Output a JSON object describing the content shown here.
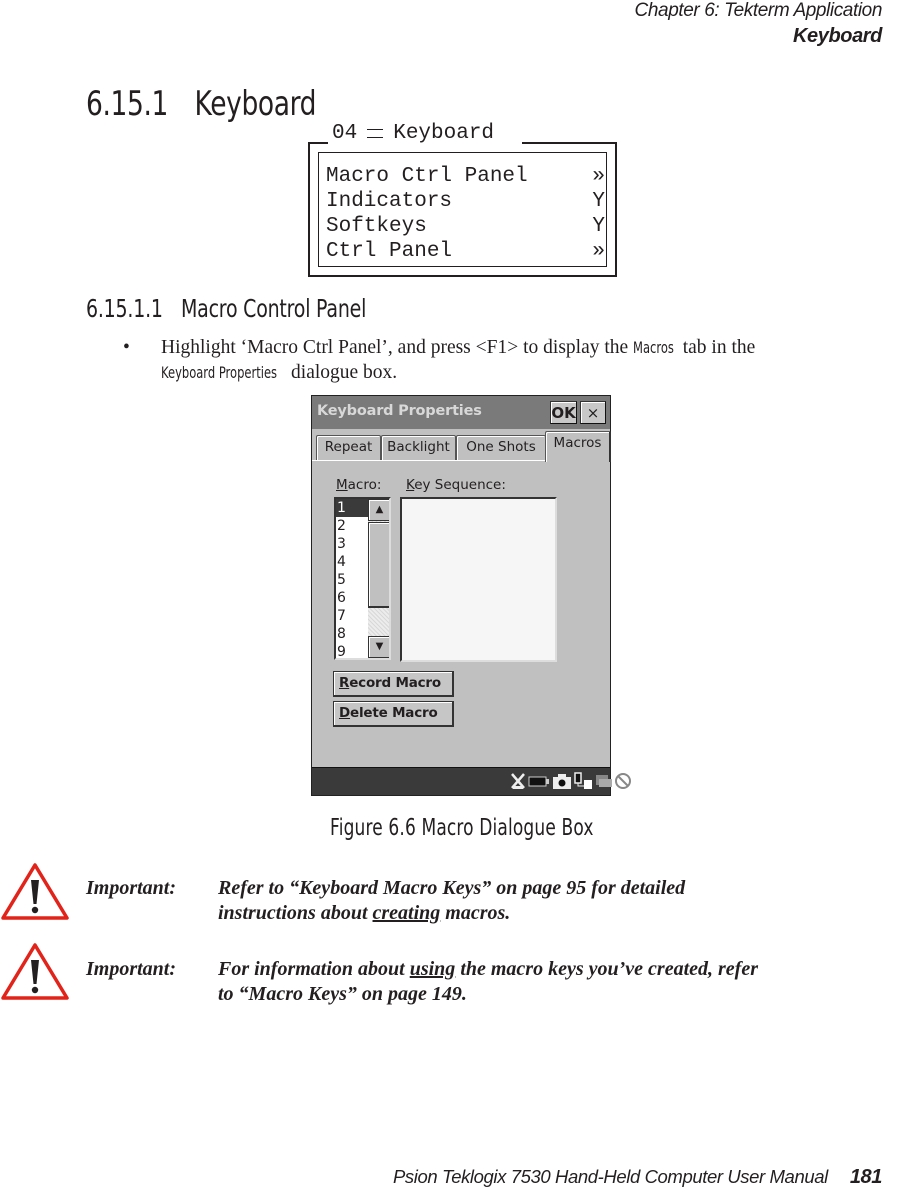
{
  "header": {
    "chapter": "Chapter  6:  Tekterm Application",
    "section": "Keyboard"
  },
  "heading1": {
    "number": "6.15.1",
    "title": "Keyboard"
  },
  "terminal_menu": {
    "screen_number": "04",
    "title": "Keyboard",
    "rows": [
      {
        "label": "Macro Ctrl Panel",
        "value": "»"
      },
      {
        "label": "Indicators",
        "value": "Y"
      },
      {
        "label": "Softkeys",
        "value": "Y"
      },
      {
        "label": "Ctrl Panel",
        "value": "»"
      }
    ]
  },
  "heading2": {
    "number": "6.15.1.1",
    "title": "Macro Control Panel"
  },
  "bullet": {
    "symbol": "•",
    "text_a": "Highlight ‘Macro Ctrl Panel’, and press <F1> to display the ",
    "ui_term_1": "Macros",
    "text_b": " tab in the ",
    "ui_term_2": "Keyboard Properties",
    "text_c": " dialogue box."
  },
  "dialog": {
    "title": "Keyboard Properties",
    "ok_label": "OK",
    "close_label": "×",
    "tabs": [
      {
        "label": "Repeat",
        "active": false
      },
      {
        "label": "Backlight",
        "active": false
      },
      {
        "label": "One Shots",
        "active": false
      },
      {
        "label": "Macros",
        "active": true
      }
    ],
    "macro_label": {
      "accel": "M",
      "rest": "acro:"
    },
    "keyseq_label": {
      "accel": "K",
      "rest": "ey Sequence:"
    },
    "macro_list": [
      "1",
      "2",
      "3",
      "4",
      "5",
      "6",
      "7",
      "8",
      "9"
    ],
    "selected_macro": "1",
    "key_sequence_value": "",
    "scroll_up": "▲",
    "scroll_down": "▼",
    "record_button": {
      "accel": "R",
      "rest": "ecord Macro"
    },
    "delete_button": {
      "accel": "D",
      "rest": "elete Macro"
    },
    "status_icons": [
      "no-network-icon",
      "battery-icon",
      "camera-icon",
      "connection-icon",
      "printer-icon",
      "no-symbol-icon"
    ]
  },
  "figure_caption": "Figure 6.6  Macro Dialogue Box",
  "notes": [
    {
      "label": "Important:",
      "line1": "Refer to “Keyboard Macro Keys” on page 95 for detailed",
      "line2_pre": "instructions about ",
      "line2_u": "creating",
      "line2_post": " macros."
    },
    {
      "label": "Important:",
      "line1_pre": "For information about ",
      "line1_u": "using",
      "line1_post": " the macro keys you’ve created, refer",
      "line2": "to “Macro Keys” on page 149."
    }
  ],
  "footer": {
    "manual_title": "Psion Teklogix 7530 Hand-Held Computer User Manual",
    "page_number": "181"
  },
  "colors": {
    "warning_red": "#e2231a",
    "titlebar": "#7a7a7a",
    "dialog_bg": "#c0c0c0",
    "statusbar": "#3a3a3a"
  }
}
